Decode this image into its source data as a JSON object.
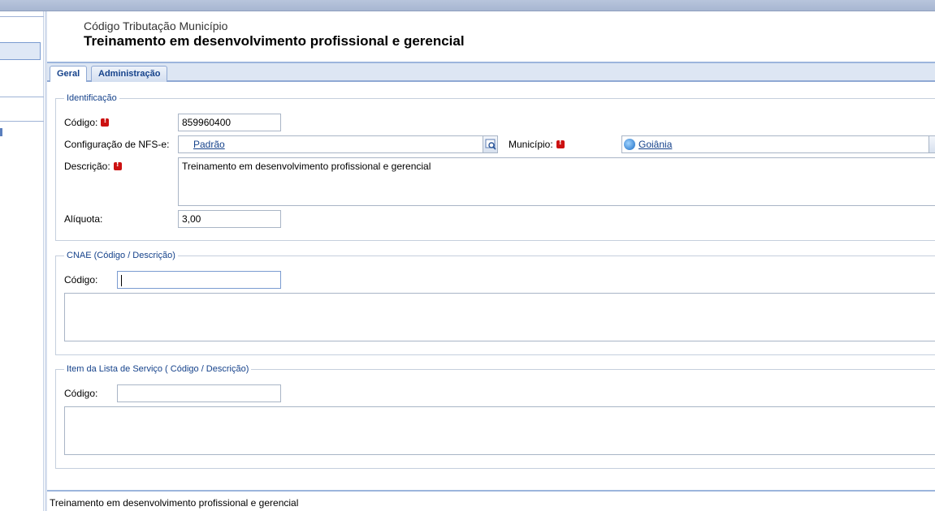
{
  "header": {
    "subtitle": "Código Tributação Município",
    "title": "Treinamento em desenvolvimento profissional e gerencial"
  },
  "tabs": [
    {
      "label": "Geral",
      "active": true
    },
    {
      "label": "Administração",
      "active": false
    }
  ],
  "identificacao": {
    "legend": "Identificação",
    "codigo_label": "Código:",
    "codigo_value": "859960400",
    "config_label": "Configuração de NFS-e:",
    "config_value": "Padrão",
    "municipio_label": "Município:",
    "municipio_value": "Goiânia",
    "descricao_label": "Descrição:",
    "descricao_value": "Treinamento em desenvolvimento profissional e gerencial",
    "aliquota_label": "Alíquota:",
    "aliquota_value": "3,00"
  },
  "cnae": {
    "legend": "CNAE (Código / Descrição)",
    "codigo_label": "Código:",
    "codigo_value": ""
  },
  "item_lista": {
    "legend": "Item da Lista de Serviço ( Código / Descrição)",
    "codigo_label": "Código:",
    "codigo_value": ""
  },
  "status": {
    "text": "Treinamento em desenvolvimento profissional e gerencial"
  },
  "icons": {
    "required": "required-icon",
    "lookup": "lookup-icon",
    "globe": "globe-icon"
  },
  "colors": {
    "accent": "#15428b",
    "required": "#cc1111",
    "tabbar": "#dde6f3"
  }
}
